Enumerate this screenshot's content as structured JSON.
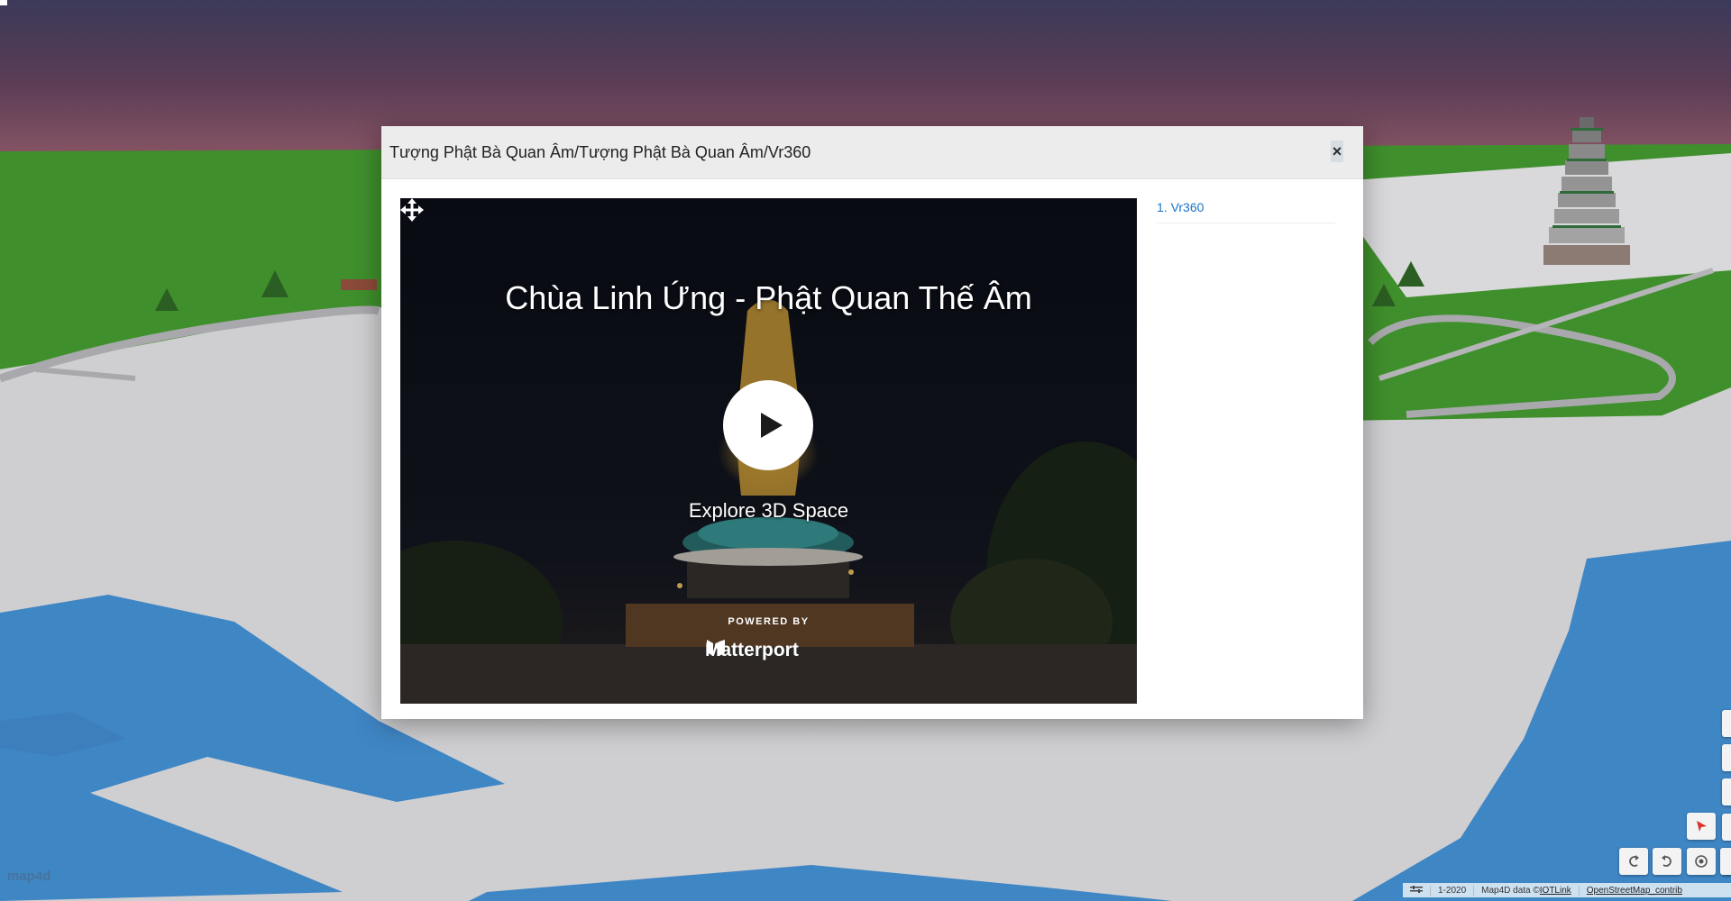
{
  "modal": {
    "title": "Tượng Phật Bà Quan Âm/Tượng Phật Bà Quan Âm/Vr360",
    "close_label": "×"
  },
  "viewer": {
    "title": "Chùa Linh Ứng - Phật Quan Thế Âm",
    "cta": "Explore 3D Space",
    "powered_by": "POWERED BY",
    "brand": "Matterport",
    "icons": {
      "play": "play-icon",
      "move": "move-icon",
      "brand": "matterport-logo"
    }
  },
  "side_list": {
    "items": [
      {
        "label": "1. Vr360"
      }
    ]
  },
  "map": {
    "logo": "map4d",
    "scale": "1-2020",
    "attribution_data": "Map4D data ©",
    "attribution_link": "IOTLink",
    "osm": "OpenStreetMap_contrib",
    "controls": [
      "location-pin-icon",
      "rotate-left-icon",
      "rotate-right-icon",
      "compass-target-icon"
    ]
  },
  "colors": {
    "accent_link": "#1a73c9",
    "grass": "#3f8f2c",
    "water": "#3f86c5",
    "ground": "#cfcfd1"
  }
}
